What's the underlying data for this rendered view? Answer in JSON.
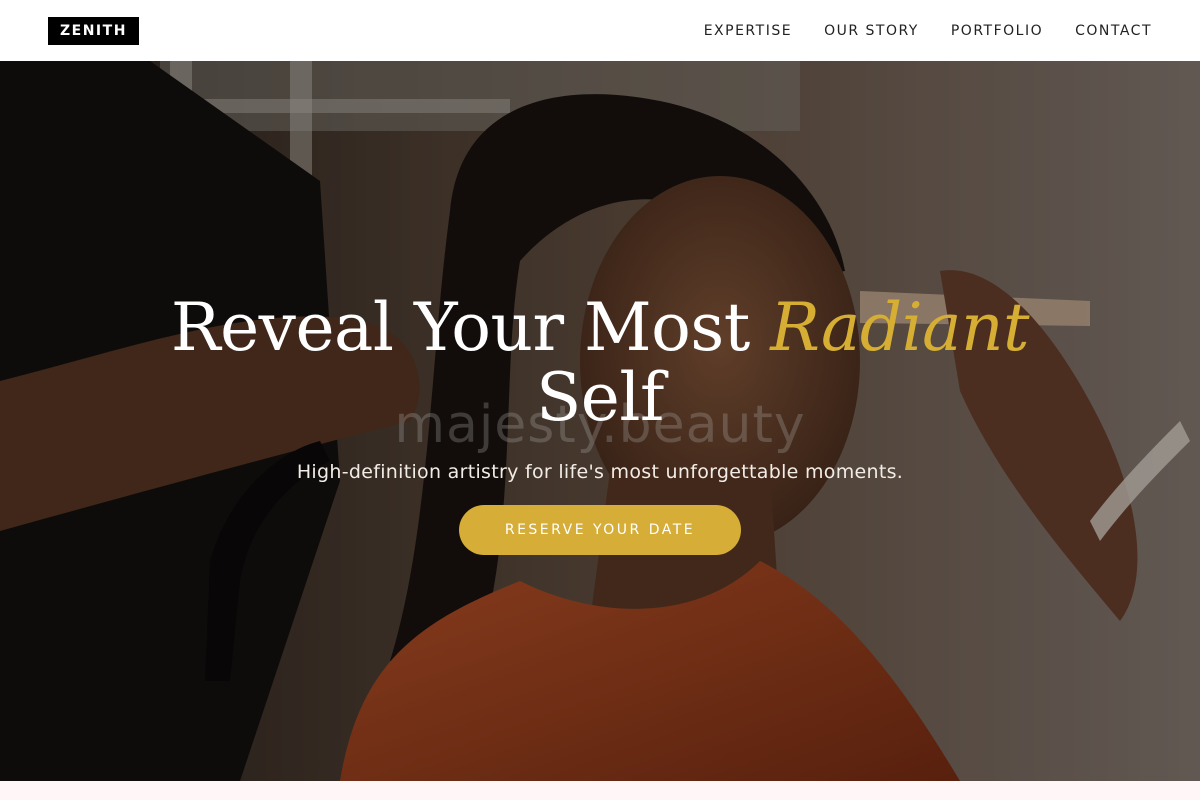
{
  "brand": {
    "logo_text": "ZENITH"
  },
  "nav": {
    "items": [
      {
        "label": "EXPERTISE"
      },
      {
        "label": "OUR STORY"
      },
      {
        "label": "PORTFOLIO"
      },
      {
        "label": "CONTACT"
      }
    ]
  },
  "hero": {
    "headline_main": "Reveal Your Most",
    "headline_accent": "Radiant",
    "headline_end": "Self",
    "watermark": "majesty.beauty",
    "subheadline": "High-definition artistry for life's most unforgettable moments.",
    "cta_label": "RESERVE YOUR DATE"
  },
  "colors": {
    "accent": "#d6ae33",
    "button": "#d5ad37",
    "nav_text": "#222222",
    "logo_bg": "#000000"
  }
}
